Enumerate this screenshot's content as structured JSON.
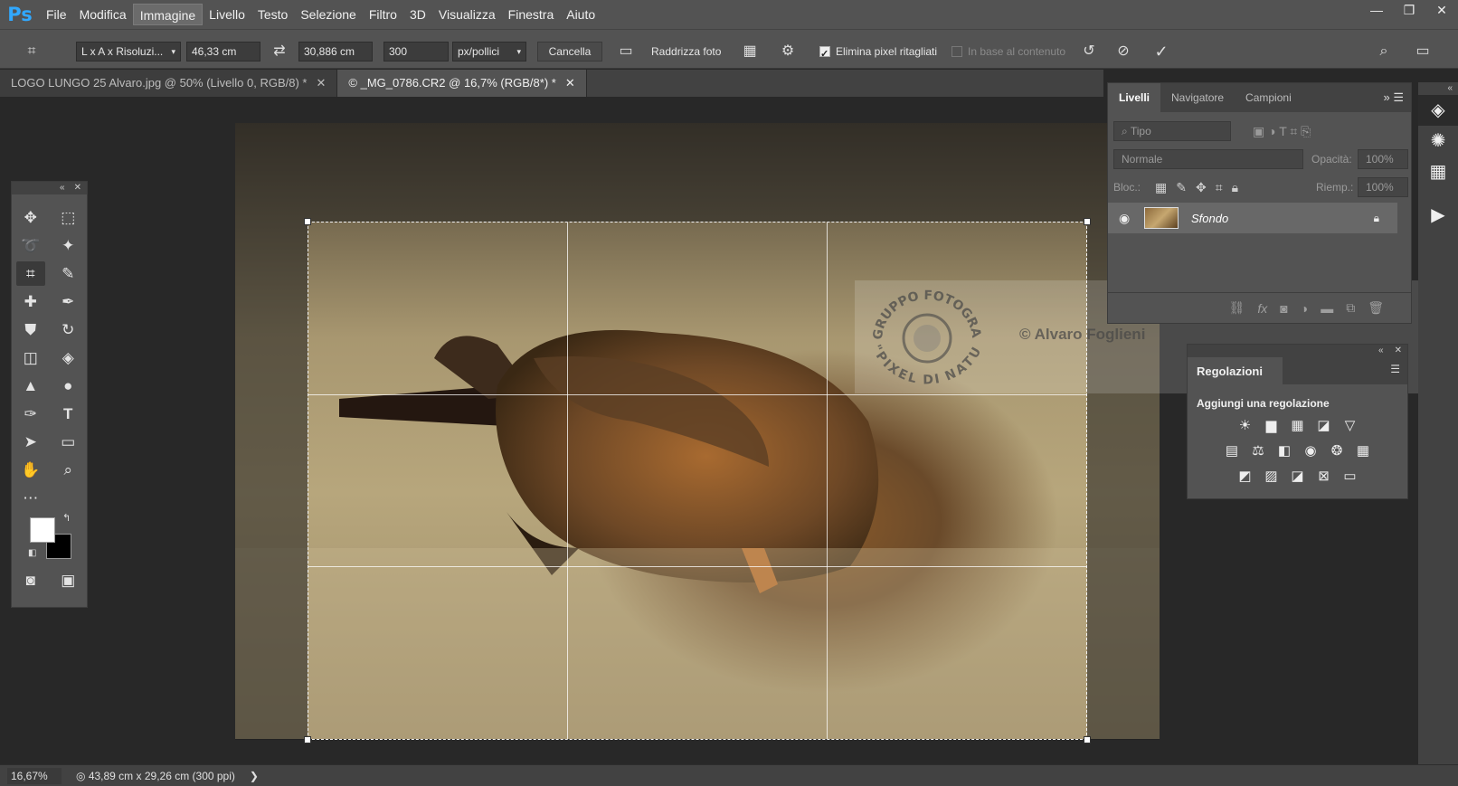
{
  "app": {
    "logo": "Ps"
  },
  "menu": [
    "File",
    "Modifica",
    "Immagine",
    "Livello",
    "Testo",
    "Selezione",
    "Filtro",
    "3D",
    "Visualizza",
    "Finestra",
    "Aiuto"
  ],
  "active_menu": "Immagine",
  "window_controls": {
    "minimize": "—",
    "restore": "❐",
    "close": "✕"
  },
  "options": {
    "tool_icon": "crop-icon",
    "ratio_select": "L x A x Risoluzi...",
    "width": "46,33 cm",
    "height": "30,886 cm",
    "resolution": "300",
    "unit_select": "px/pollici",
    "clear_label": "Cancella",
    "straighten_label": "Raddrizza foto",
    "delete_pixels_label": "Elimina pixel ritagliati",
    "content_aware_label": "In base al contenuto"
  },
  "tabs": [
    {
      "label": "LOGO LUNGO 25 Alvaro.jpg @ 50% (Livello 0, RGB/8) *",
      "close": "✕"
    },
    {
      "label": "© _MG_0786.CR2 @ 16,7% (RGB/8*) *",
      "close": "✕"
    }
  ],
  "layers_panel": {
    "tabs": [
      "Livelli",
      "Navigatore",
      "Campioni"
    ],
    "filter_placeholder": "Tipo",
    "blend_mode": "Normale",
    "opacity_label": "Opacità:",
    "opacity_value": "100%",
    "lock_label": "Bloc.:",
    "fill_label": "Riemp.:",
    "fill_value": "100%",
    "layer_name": "Sfondo",
    "footer_icons": [
      "link-icon",
      "fx-icon",
      "mask-icon",
      "adjustment-icon",
      "folder-icon",
      "new-layer-icon",
      "trash-icon"
    ]
  },
  "adjustments_panel": {
    "title": "Regolazioni",
    "subtitle": "Aggiungi una regolazione"
  },
  "watermark": {
    "seal_top": "GRUPPO FOTOGRAFICO",
    "seal_bottom": "\"PIXEL DI NATURA\"",
    "text": "© Alvaro Foglieni"
  },
  "status": {
    "zoom": "16,67%",
    "doc_info": "43,89 cm x 29,26 cm (300 ppi)",
    "arrow": "❯"
  }
}
